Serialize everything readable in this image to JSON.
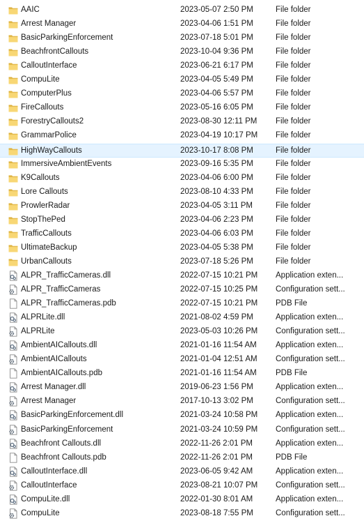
{
  "explorer": {
    "rows": [
      {
        "name": "AAIC",
        "date": "2023-05-07 2:50 PM",
        "type": "File folder",
        "icon": "folder-icon"
      },
      {
        "name": "Arrest Manager",
        "date": "2023-04-06 1:51 PM",
        "type": "File folder",
        "icon": "folder-icon"
      },
      {
        "name": "BasicParkingEnforcement",
        "date": "2023-07-18 5:01 PM",
        "type": "File folder",
        "icon": "folder-icon"
      },
      {
        "name": "BeachfrontCallouts",
        "date": "2023-10-04 9:36 PM",
        "type": "File folder",
        "icon": "folder-icon"
      },
      {
        "name": "CalloutInterface",
        "date": "2023-06-21 6:17 PM",
        "type": "File folder",
        "icon": "folder-icon"
      },
      {
        "name": "CompuLite",
        "date": "2023-04-05 5:49 PM",
        "type": "File folder",
        "icon": "folder-icon"
      },
      {
        "name": "ComputerPlus",
        "date": "2023-04-06 5:57 PM",
        "type": "File folder",
        "icon": "folder-icon"
      },
      {
        "name": "FireCallouts",
        "date": "2023-05-16 6:05 PM",
        "type": "File folder",
        "icon": "folder-icon"
      },
      {
        "name": "ForestryCallouts2",
        "date": "2023-08-30 12:11 PM",
        "type": "File folder",
        "icon": "folder-icon"
      },
      {
        "name": "GrammarPolice",
        "date": "2023-04-19 10:17 PM",
        "type": "File folder",
        "icon": "folder-icon"
      },
      {
        "name": "HighWayCallouts",
        "date": "2023-10-17 8:08 PM",
        "type": "File folder",
        "icon": "folder-icon",
        "selected": true
      },
      {
        "name": "ImmersiveAmbientEvents",
        "date": "2023-09-16 5:35 PM",
        "type": "File folder",
        "icon": "folder-icon"
      },
      {
        "name": "K9Callouts",
        "date": "2023-04-06 6:00 PM",
        "type": "File folder",
        "icon": "folder-icon"
      },
      {
        "name": "Lore Callouts",
        "date": "2023-08-10 4:33 PM",
        "type": "File folder",
        "icon": "folder-icon"
      },
      {
        "name": "ProwlerRadar",
        "date": "2023-04-05 3:11 PM",
        "type": "File folder",
        "icon": "folder-icon"
      },
      {
        "name": "StopThePed",
        "date": "2023-04-06 2:23 PM",
        "type": "File folder",
        "icon": "folder-icon"
      },
      {
        "name": "TrafficCallouts",
        "date": "2023-04-06 6:03 PM",
        "type": "File folder",
        "icon": "folder-icon"
      },
      {
        "name": "UltimateBackup",
        "date": "2023-04-05 5:38 PM",
        "type": "File folder",
        "icon": "folder-icon"
      },
      {
        "name": "UrbanCallouts",
        "date": "2023-07-18 5:26 PM",
        "type": "File folder",
        "icon": "folder-icon"
      },
      {
        "name": "ALPR_TrafficCameras.dll",
        "date": "2022-07-15 10:21 PM",
        "type": "Application exten...",
        "icon": "dll-file-icon"
      },
      {
        "name": "ALPR_TrafficCameras",
        "date": "2022-07-15 10:25 PM",
        "type": "Configuration sett...",
        "icon": "config-file-icon"
      },
      {
        "name": "ALPR_TrafficCameras.pdb",
        "date": "2022-07-15 10:21 PM",
        "type": "PDB File",
        "icon": "blank-file-icon"
      },
      {
        "name": "ALPRLite.dll",
        "date": "2021-08-02 4:59 PM",
        "type": "Application exten...",
        "icon": "dll-file-icon"
      },
      {
        "name": "ALPRLite",
        "date": "2023-05-03 10:26 PM",
        "type": "Configuration sett...",
        "icon": "config-file-icon"
      },
      {
        "name": "AmbientAICallouts.dll",
        "date": "2021-01-16 11:54 AM",
        "type": "Application exten...",
        "icon": "dll-file-icon"
      },
      {
        "name": "AmbientAICallouts",
        "date": "2021-01-04 12:51 AM",
        "type": "Configuration sett...",
        "icon": "config-file-icon"
      },
      {
        "name": "AmbientAICallouts.pdb",
        "date": "2021-01-16 11:54 AM",
        "type": "PDB File",
        "icon": "blank-file-icon"
      },
      {
        "name": "Arrest Manager.dll",
        "date": "2019-06-23 1:56 PM",
        "type": "Application exten...",
        "icon": "dll-file-icon"
      },
      {
        "name": "Arrest Manager",
        "date": "2017-10-13 3:02 PM",
        "type": "Configuration sett...",
        "icon": "config-file-icon"
      },
      {
        "name": "BasicParkingEnforcement.dll",
        "date": "2021-03-24 10:58 PM",
        "type": "Application exten...",
        "icon": "dll-file-icon"
      },
      {
        "name": "BasicParkingEnforcement",
        "date": "2021-03-24 10:59 PM",
        "type": "Configuration sett...",
        "icon": "config-file-icon"
      },
      {
        "name": "Beachfront Callouts.dll",
        "date": "2022-11-26 2:01 PM",
        "type": "Application exten...",
        "icon": "dll-file-icon"
      },
      {
        "name": "Beachfront Callouts.pdb",
        "date": "2022-11-26 2:01 PM",
        "type": "PDB File",
        "icon": "blank-file-icon"
      },
      {
        "name": "CalloutInterface.dll",
        "date": "2023-06-05 9:42 AM",
        "type": "Application exten...",
        "icon": "dll-file-icon"
      },
      {
        "name": "CalloutInterface",
        "date": "2023-08-21 10:07 PM",
        "type": "Configuration sett...",
        "icon": "config-file-icon"
      },
      {
        "name": "CompuLite.dll",
        "date": "2022-01-30 8:01 AM",
        "type": "Application exten...",
        "icon": "dll-file-icon"
      },
      {
        "name": "CompuLite",
        "date": "2023-08-18 7:55 PM",
        "type": "Configuration sett...",
        "icon": "config-file-icon"
      }
    ]
  }
}
